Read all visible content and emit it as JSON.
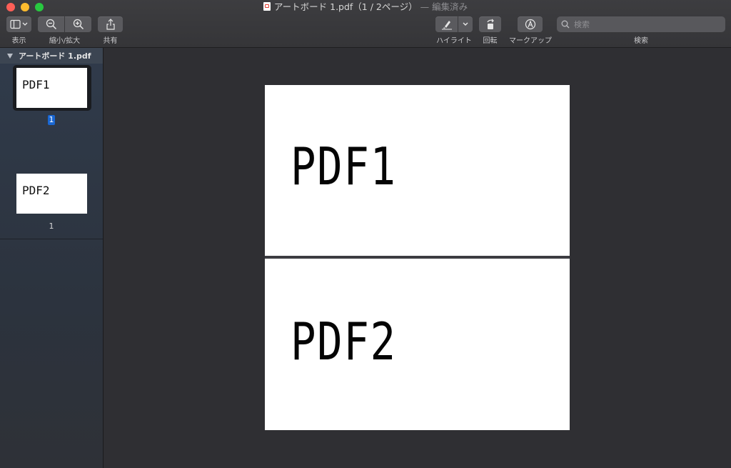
{
  "window": {
    "title": "アートボード 1.pdf（1 / 2ページ）",
    "edited_suffix": "— 編集済み"
  },
  "toolbar": {
    "view_label": "表示",
    "zoom_label": "縮小/拡大",
    "share_label": "共有",
    "highlight_label": "ハイライト",
    "rotate_label": "回転",
    "markup_label": "マークアップ",
    "search_label": "検索",
    "search_placeholder": "検索"
  },
  "sidebar": {
    "document_name": "アートボード 1.pdf",
    "thumbnails": [
      {
        "text": "PDF1",
        "page_label": "1",
        "selected": true
      },
      {
        "text": "PDF2",
        "page_label": "1",
        "selected": false
      }
    ]
  },
  "document": {
    "pages": [
      {
        "text": "PDF1"
      },
      {
        "text": "PDF2"
      }
    ]
  },
  "colors": {
    "close": "#fe5f57",
    "minimize": "#febc2e",
    "maximize": "#28c840",
    "selection": "#1a67d2"
  }
}
